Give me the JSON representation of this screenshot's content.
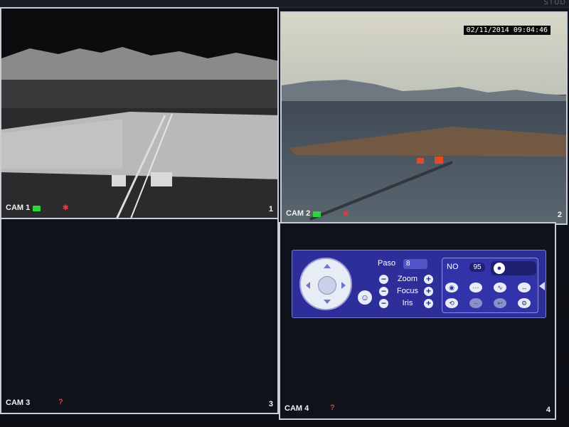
{
  "topbar": {
    "corner_text": "STUD"
  },
  "cameras": [
    {
      "label": "CAM 1",
      "number": "1"
    },
    {
      "label": "CAM 2",
      "number": "2",
      "timestamp": "02/11/2014 09:04:46"
    },
    {
      "label": "CAM 3",
      "number": "3"
    },
    {
      "label": "CAM 4",
      "number": "4"
    }
  ],
  "ptz": {
    "paso_label": "Paso",
    "paso_value": "8",
    "zoom_label": "Zoom",
    "focus_label": "Focus",
    "iris_label": "Iris",
    "no_label": "NO",
    "no_value": "95",
    "icons": [
      "joystick-icon",
      "face-icon",
      "bulb-icon",
      "camera-icon",
      "pattern-icon",
      "tour-icon",
      "scan-icon",
      "aux-icon",
      "disabled-1-icon",
      "undo-icon",
      "settings-icon"
    ]
  },
  "colors": {
    "panel": "#2d2e9a",
    "record_indicator": "#2bd63a",
    "alarm": "#e23a3a"
  }
}
